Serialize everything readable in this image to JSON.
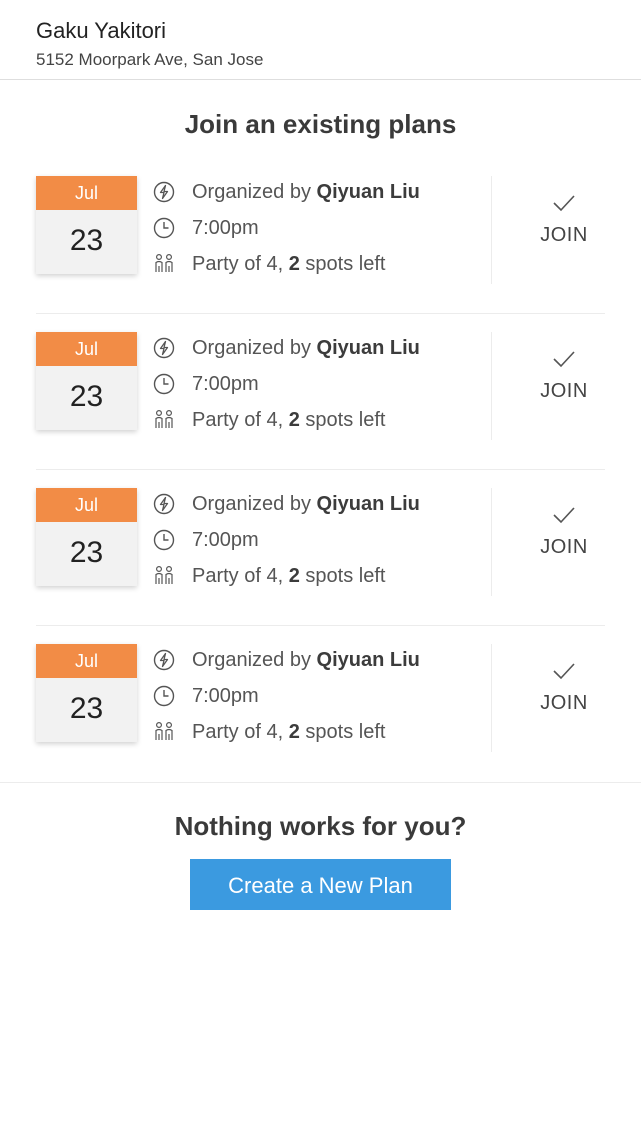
{
  "header": {
    "restaurant_name": "Gaku Yakitori",
    "address": "5152 Moorpark Ave, San Jose"
  },
  "section_title": "Join an existing plans",
  "plans": [
    {
      "month": "Jul",
      "day": "23",
      "organizer_prefix": "Organized by ",
      "organizer": "Qiyuan Liu",
      "time": "7:00pm",
      "party_prefix": "Party of 4, ",
      "spots": "2",
      "spots_suffix": " spots left",
      "join_label": "JOIN"
    },
    {
      "month": "Jul",
      "day": "23",
      "organizer_prefix": "Organized by ",
      "organizer": "Qiyuan Liu",
      "time": "7:00pm",
      "party_prefix": "Party of 4, ",
      "spots": "2",
      "spots_suffix": " spots left",
      "join_label": "JOIN"
    },
    {
      "month": "Jul",
      "day": "23",
      "organizer_prefix": "Organized by ",
      "organizer": "Qiyuan Liu",
      "time": "7:00pm",
      "party_prefix": "Party of 4, ",
      "spots": "2",
      "spots_suffix": " spots left",
      "join_label": "JOIN"
    },
    {
      "month": "Jul",
      "day": "23",
      "organizer_prefix": "Organized by ",
      "organizer": "Qiyuan Liu",
      "time": "7:00pm",
      "party_prefix": "Party of 4, ",
      "spots": "2",
      "spots_suffix": " spots left",
      "join_label": "JOIN"
    }
  ],
  "footer": {
    "question": "Nothing works for you?",
    "create_button": "Create a New Plan"
  },
  "colors": {
    "month_bg": "#f28c46",
    "button_bg": "#3b9ae0"
  },
  "icons": {
    "organizer": "lightning-circle-icon",
    "time": "clock-icon",
    "party": "people-icon",
    "join": "checkmark-icon"
  }
}
